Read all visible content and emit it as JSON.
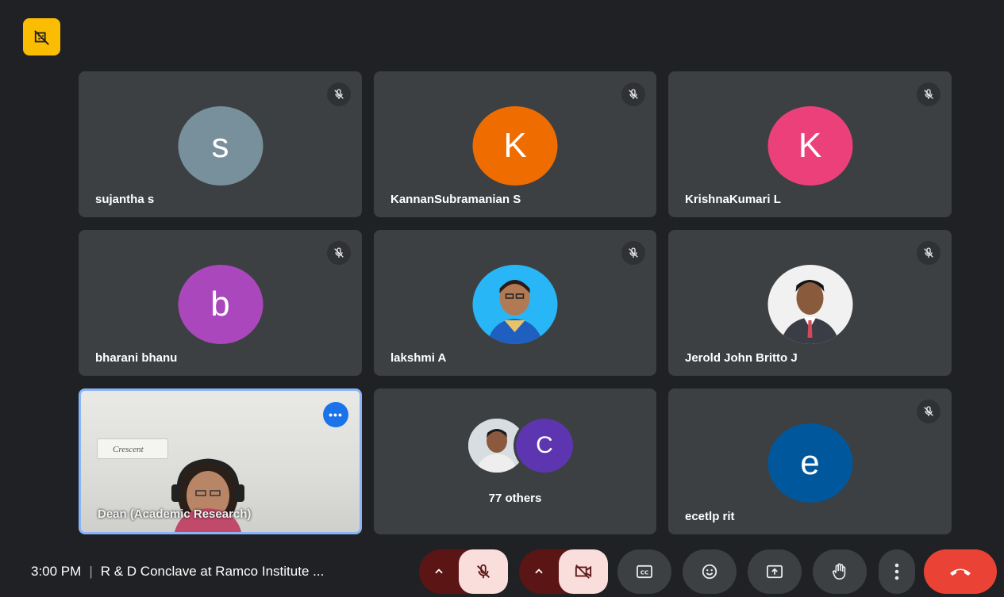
{
  "meeting": {
    "time": "3:00 PM",
    "separator": "|",
    "title": "R & D Conclave at Ramco Institute ..."
  },
  "participants": [
    {
      "name": "sujantha s",
      "initial": "s",
      "avatar_color": "#78909c",
      "muted": true
    },
    {
      "name": "KannanSubramanian S",
      "initial": "K",
      "avatar_color": "#ef6c00",
      "muted": true
    },
    {
      "name": "KrishnaKumari L",
      "initial": "K",
      "avatar_color": "#ec407a",
      "muted": true
    },
    {
      "name": "bharani bhanu",
      "initial": "b",
      "avatar_color": "#ab47bc",
      "muted": true
    },
    {
      "name": "lakshmi A",
      "initial": "",
      "avatar_color": "#29b6f6",
      "muted": true
    },
    {
      "name": "Jerold John Britto J",
      "initial": "",
      "avatar_color": "#ffffff",
      "muted": true
    },
    {
      "name": "Dean (Academic Research)",
      "video_banner_text": "Crescent",
      "active": true
    },
    {
      "others_label": "77 others",
      "others_initial": "C",
      "others_color": "#5e35b1"
    },
    {
      "name": "ecetlp rit",
      "initial": "e",
      "avatar_color": "#01579b",
      "muted": true
    }
  ],
  "colors": {
    "background": "#202124",
    "tile": "#3c4043",
    "recording_badge": "#fbbc04",
    "active_border": "#8ab4f8",
    "hangup": "#ea4335",
    "muted_control": "#f9dedc"
  },
  "controls": {
    "mic": {
      "icon": "mic-off-icon",
      "state": "off"
    },
    "camera": {
      "icon": "camera-off-icon",
      "state": "off"
    },
    "captions": {
      "icon": "captions-icon"
    },
    "reactions": {
      "icon": "emoji-icon"
    },
    "present": {
      "icon": "present-screen-icon"
    },
    "raise_hand": {
      "icon": "hand-icon"
    },
    "more": {
      "icon": "more-vert-icon"
    },
    "leave": {
      "icon": "call-end-icon"
    }
  }
}
